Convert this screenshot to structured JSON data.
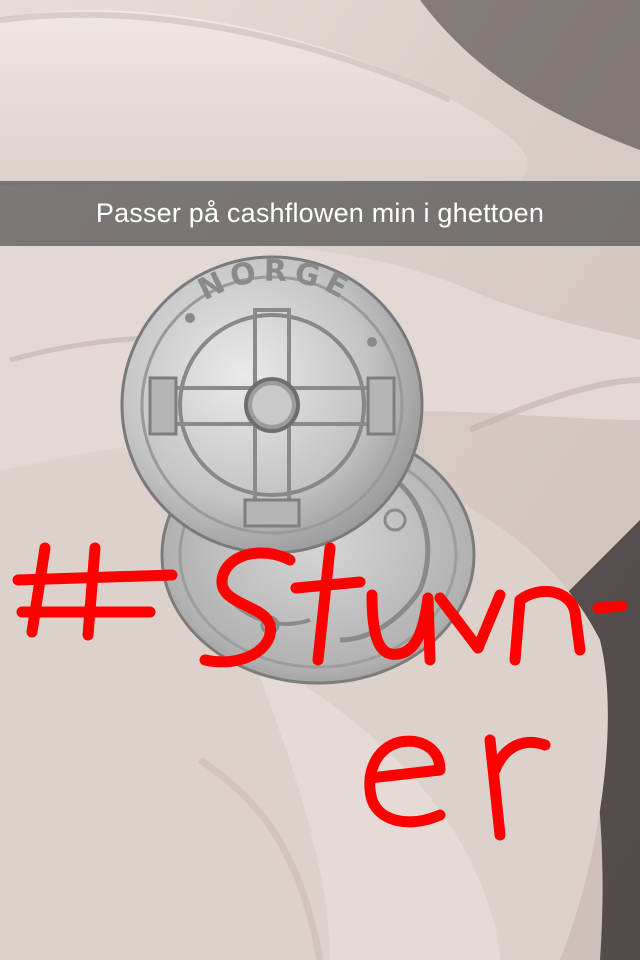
{
  "caption": {
    "text": "Passer på cashflowen min i ghettoen"
  },
  "coin_front": {
    "inscription": "NORGE"
  },
  "drawing": {
    "text": "#Stuvn- er",
    "color": "#ff0000"
  },
  "icons": {
    "coin_front": "one-krone-coin-icon",
    "coin_back": "krone-coin-back-icon",
    "hand": "hand-icon"
  }
}
